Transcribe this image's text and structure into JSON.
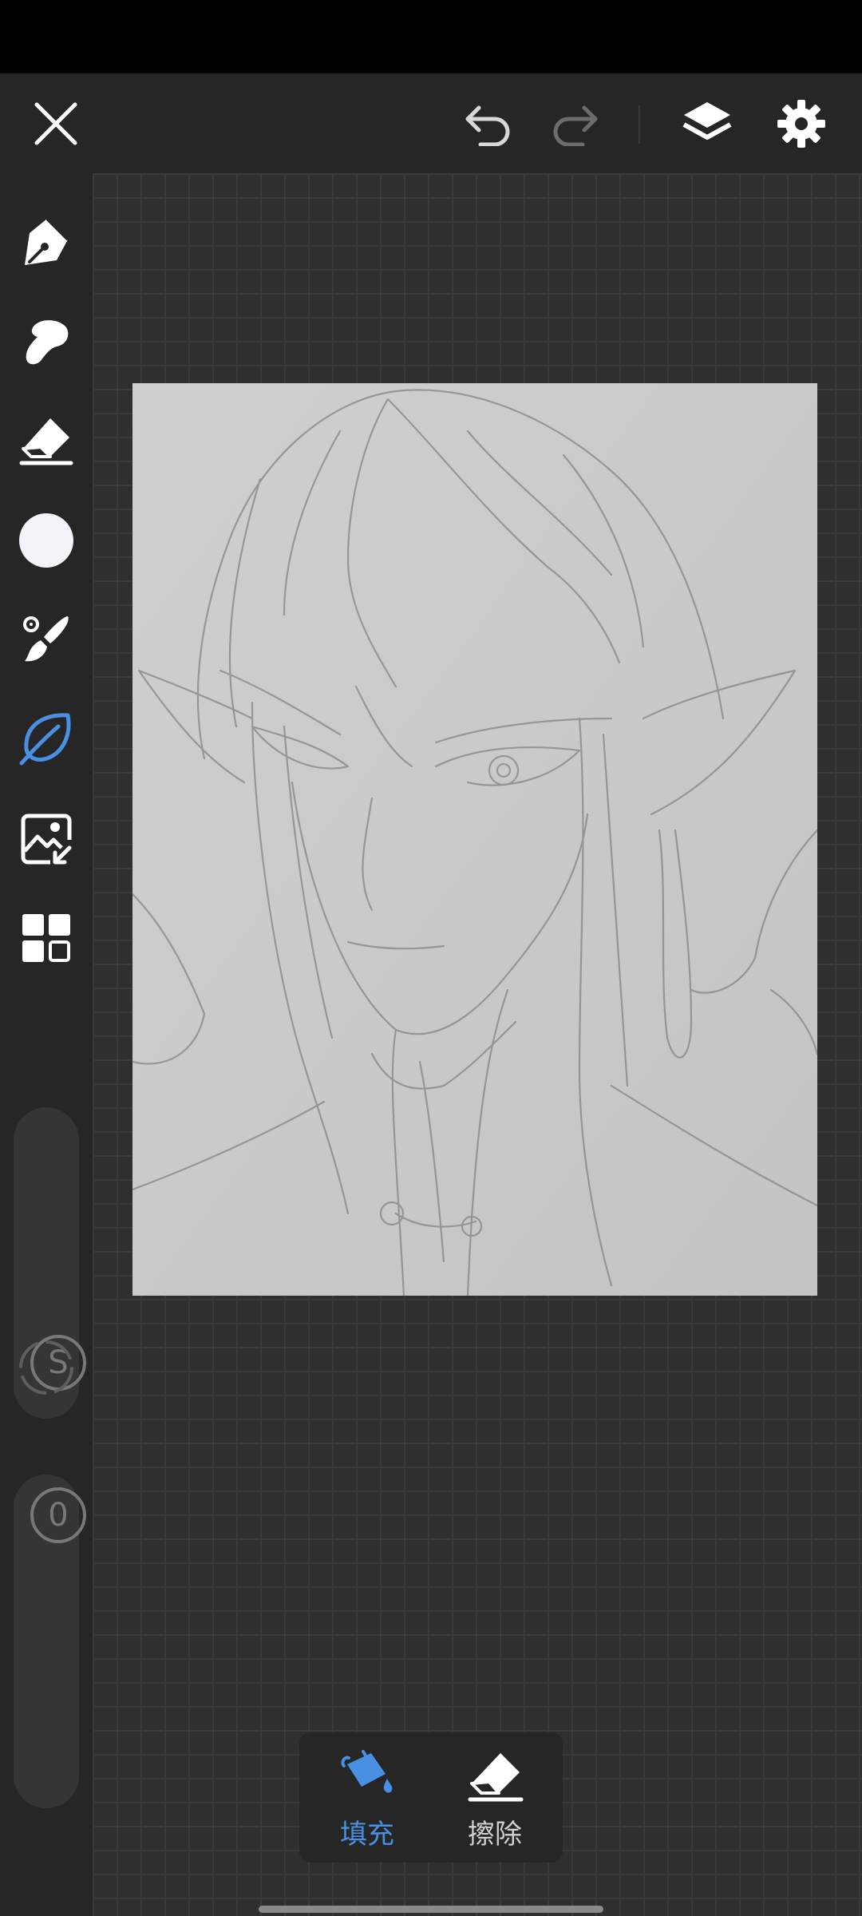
{
  "toolbar": {
    "close_icon": "close-icon",
    "undo_icon": "undo-icon",
    "redo_icon": "redo-icon",
    "layers_icon": "layers-icon",
    "settings_icon": "gear-icon"
  },
  "sidebar": {
    "tools": [
      {
        "name": "pen-tool",
        "icon": "pen-nib-icon"
      },
      {
        "name": "smudge-tool",
        "icon": "smudge-icon"
      },
      {
        "name": "eraser-tool",
        "icon": "eraser-icon"
      },
      {
        "name": "color-picker",
        "icon": "color-swatch-icon",
        "color": "#f4f4f8"
      },
      {
        "name": "brush-tool",
        "icon": "brush-icon"
      },
      {
        "name": "fill-tool",
        "icon": "leaf-icon",
        "active": true
      },
      {
        "name": "image-import",
        "icon": "image-import-icon"
      },
      {
        "name": "more-tools",
        "icon": "grid-icon"
      }
    ],
    "size_value": "S",
    "opacity_value": "0"
  },
  "bottom_panel": {
    "fill_label": "填充",
    "erase_label": "擦除",
    "active": "fill"
  },
  "colors": {
    "accent": "#4a90e2",
    "background": "#2d2d2e",
    "panel": "#262627",
    "icon": "#ffffff",
    "icon_disabled": "#6c6c6e",
    "paper": "#c9c9c8"
  }
}
